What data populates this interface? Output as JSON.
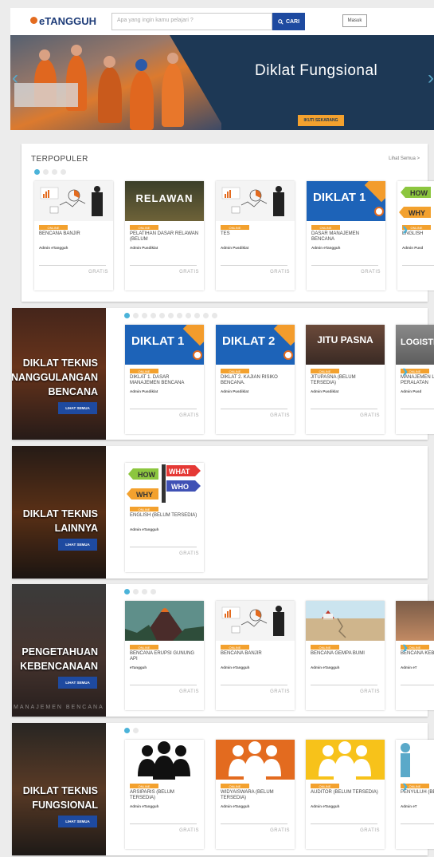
{
  "header": {
    "logo": "eTANGGUH",
    "search_placeholder": "Apa yang ingin kamu pelajari ?",
    "search_button": "CARI",
    "login": "Masuk"
  },
  "hero": {
    "title": "Diklat Fungsional",
    "cta": "IKUTI SEKARANG"
  },
  "popular": {
    "title": "TERPOPULER",
    "see_all": "Lihat Semua >",
    "cards": [
      {
        "tag": "ONLINE",
        "title": "BENCANA BANJIR",
        "admin": "Admin eTangguh",
        "price": "GRATIS",
        "thumb": "chart"
      },
      {
        "tag": "ONLINE",
        "title": "PELATIHAN DASAR RELAWAN (belum",
        "admin": "Admin Pusdiklat",
        "price": "GRATIS",
        "thumb": "relawan",
        "thumb_text": "RELAWAN"
      },
      {
        "tag": "ONLINE",
        "title": "tes",
        "admin": "Admin Pusdiklat",
        "price": "GRATIS",
        "thumb": "chart"
      },
      {
        "tag": "ONLINE",
        "title": "DASAR MANAJEMEN BENCANA",
        "admin": "Admin eTangguh",
        "price": "GRATIS",
        "thumb": "diklat",
        "thumb_text": "DIKLAT 1"
      },
      {
        "tag": "ONLINE",
        "title": "ENGLISH",
        "admin": "Admin Pusd",
        "price": "",
        "thumb": "how",
        "thumb_text": "HOW WHY"
      }
    ]
  },
  "sections": [
    {
      "name": "DIKLAT TEKNIS PENANGGULANGAN BENCANA",
      "lines": [
        "DIKLAT TEKNIS",
        "PENANGGULANGAN",
        "BENCANA"
      ],
      "button": "LIHAT SEMUA",
      "cards": [
        {
          "tag": "ONLINE",
          "title": "DIKLAT 1. DASAR MANAJEMEN BENCANA",
          "admin": "Admin Pusdiklat",
          "price": "GRATIS",
          "thumb": "diklat",
          "thumb_text": "DIKLAT 1"
        },
        {
          "tag": "ONLINE",
          "title": "DIKLAT 2. KAJIAN RISIKO BENCANA.",
          "admin": "Admin Pusdiklat",
          "price": "GRATIS",
          "thumb": "diklat",
          "thumb_text": "DIKLAT 2"
        },
        {
          "tag": "ONLINE",
          "title": "JITUPASNA (belum tersedia)",
          "admin": "Admin Pusdiklat",
          "price": "GRATIS",
          "thumb": "jitu",
          "thumb_text": "JITU PASNA"
        },
        {
          "tag": "ONLINE",
          "title": "MANAJEMEN LOGISTIK DAN PERALATAN",
          "admin": "Admin Pusd",
          "price": "",
          "thumb": "logistik",
          "thumb_text": "LOGISTIK"
        }
      ]
    },
    {
      "name": "DIKLAT TEKNIS LAINNYA",
      "lines": [
        "DIKLAT TEKNIS",
        "LAINNYA"
      ],
      "button": "LIHAT SEMUA",
      "cards": [
        {
          "tag": "ONLINE",
          "title": "ENGLISH (Belum Tersedia)",
          "admin": "Admin eTangguh",
          "price": "GRATIS",
          "thumb": "how",
          "thumb_text": "HOW WHAT WHO WHY"
        }
      ]
    },
    {
      "name": "PENGETAHUAN KEBENCANAAN",
      "lines": [
        "PENGETAHUAN",
        "KEBENCANAAN"
      ],
      "button": "LIHAT SEMUA",
      "watermark": "MANAJEMEN BENCANA",
      "cards": [
        {
          "tag": "ONLINE",
          "title": "BENCANA ERUPSI GUNUNG API",
          "admin": "eTangguh",
          "price": "GRATIS",
          "thumb": "volcano"
        },
        {
          "tag": "ONLINE",
          "title": "BENCANA BANJIR",
          "admin": "Admin eTangguh",
          "price": "GRATIS",
          "thumb": "chart"
        },
        {
          "tag": "ONLINE",
          "title": "BENCANA GEMPA BUMI",
          "admin": "Admin eTangguh",
          "price": "GRATIS",
          "thumb": "quake"
        },
        {
          "tag": "ONLINE",
          "title": "BENCANA KEBAKARAN",
          "admin": "Admin eT",
          "price": "",
          "thumb": "fire"
        }
      ]
    },
    {
      "name": "DIKLAT TEKNIS FUNGSIONAL",
      "lines": [
        "DIKLAT TEKNIS",
        "FUNGSIONAL"
      ],
      "button": "LIHAT SEMUA",
      "cards": [
        {
          "tag": "ONLINE",
          "title": "ARSIPARIS (Belum Tersedia)",
          "admin": "Admin eTangguh",
          "price": "GRATIS",
          "thumb": "people-black"
        },
        {
          "tag": "ONLINE",
          "title": "WIDYAISWARA (Belum Tersedia)",
          "admin": "Admin eTangguh",
          "price": "GRATIS",
          "thumb": "people-orange"
        },
        {
          "tag": "ONLINE",
          "title": "AUDITOR (Belum Tersedia)",
          "admin": "Admin eTangguh",
          "price": "GRATIS",
          "thumb": "people-yellow"
        },
        {
          "tag": "ONLINE",
          "title": "PENYULUH (Belum",
          "admin": "Admin eT",
          "price": "",
          "thumb": "person-blue"
        }
      ]
    }
  ],
  "colors": {
    "accent": "#1e4aa0",
    "tag": "#f3a12e",
    "dot": "#4bb3d9",
    "hero": "#1d3855"
  }
}
